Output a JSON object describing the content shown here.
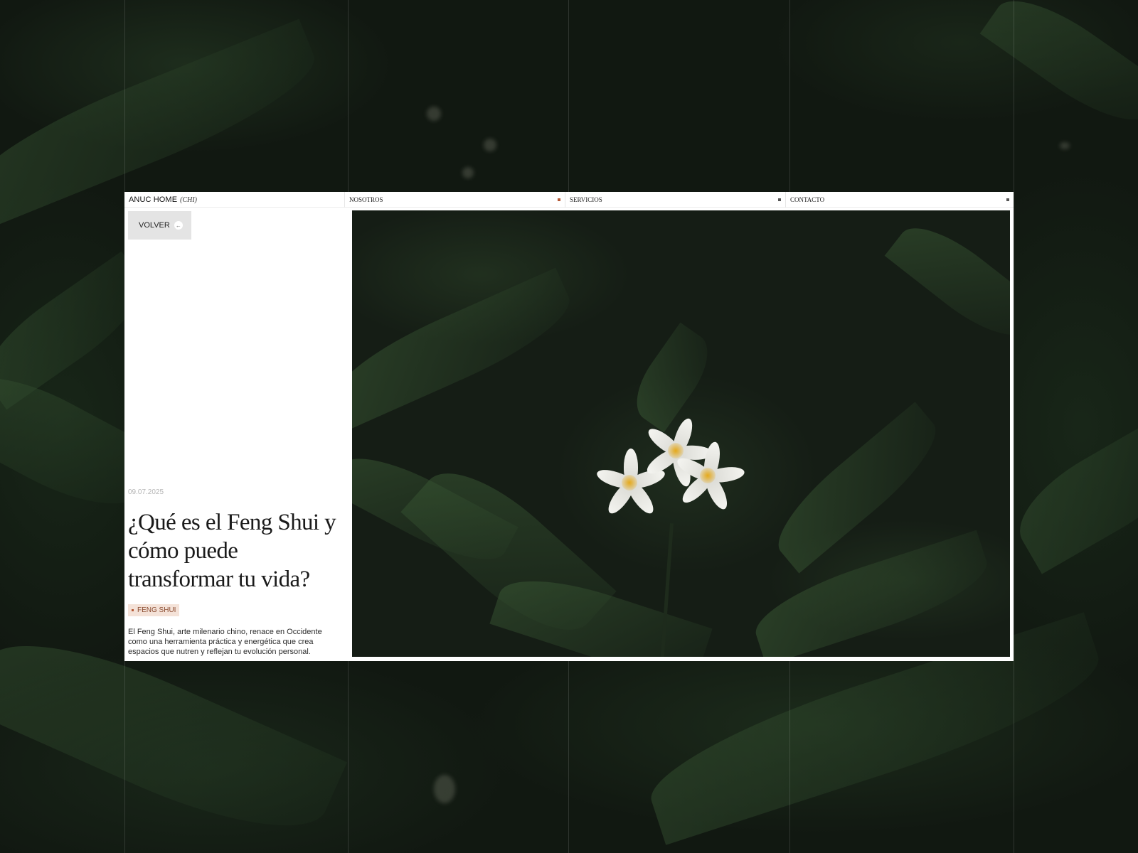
{
  "brand": {
    "name": "ANUC HOME",
    "sub": "(CHI)"
  },
  "nav": {
    "items": [
      {
        "label": "NOSOTROS",
        "accent": true
      },
      {
        "label": "SERVICIOS",
        "accent": false
      },
      {
        "label": "CONTACTO",
        "accent": false
      }
    ]
  },
  "back_button": {
    "label": "VOLVER",
    "icon": "arrow-left-icon"
  },
  "article": {
    "date": "09.07.2025",
    "title": "¿Qué es el Feng Shui y cómo puede transformar tu vida?",
    "tag": "FENG SHUI",
    "excerpt": "El Feng Shui, arte milenario chino, renace en Occidente como una herramienta práctica y energética que crea espacios que nutren y reflejan tu evolución personal."
  },
  "colors": {
    "accent": "#b65a36",
    "tag_bg": "#f4e2d8",
    "panel_bg": "#ffffff",
    "page_bg": "#111811"
  }
}
